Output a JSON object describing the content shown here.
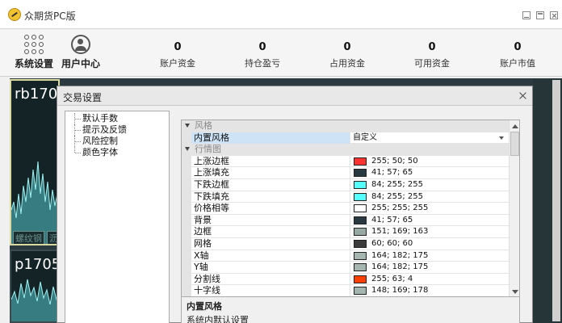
{
  "window": {
    "title": "众期货PC版"
  },
  "toolbar": {
    "system_settings": "系统设置",
    "user_center": "用户中心",
    "stats": [
      {
        "value": "0",
        "label": "账户资金"
      },
      {
        "value": "0",
        "label": "持仓盈亏"
      },
      {
        "value": "0",
        "label": "占用资金"
      },
      {
        "value": "0",
        "label": "可用资金"
      },
      {
        "value": "0",
        "label": "账户市值"
      }
    ]
  },
  "charts": {
    "panel1_symbol": "rb170",
    "panel2_symbol": "p1705",
    "tag1": "螺纹钢",
    "tag2": "沥"
  },
  "dialog": {
    "title": "交易设置",
    "tree": [
      "默认手数",
      "提示及反馈",
      "风险控制",
      "颜色字体"
    ],
    "grid": {
      "cat_style": "风格",
      "style_row": {
        "name": "内置风格",
        "value": "自定义"
      },
      "cat_market": "行情图",
      "rows": [
        {
          "name": "上涨边框",
          "color": "#ff3232",
          "value": "255; 50; 50"
        },
        {
          "name": "上涨填充",
          "color": "#293941",
          "value": "41; 57; 65"
        },
        {
          "name": "下跌边框",
          "color": "#54ffff",
          "value": "84; 255; 255"
        },
        {
          "name": "下跌填充",
          "color": "#54ffff",
          "value": "84; 255; 255"
        },
        {
          "name": "价格相等",
          "color": "#ffffff",
          "value": "255; 255; 255"
        },
        {
          "name": "背景",
          "color": "#293941",
          "value": "41; 57; 65"
        },
        {
          "name": "边框",
          "color": "#97a9a3",
          "value": "151; 169; 163"
        },
        {
          "name": "网格",
          "color": "#3c3c3c",
          "value": "60; 60; 60"
        },
        {
          "name": "X轴",
          "color": "#a4b6af",
          "value": "164; 182; 175"
        },
        {
          "name": "Y轴",
          "color": "#a4b6af",
          "value": "164; 182; 175"
        },
        {
          "name": "分割线",
          "color": "#ff3f04",
          "value": "255; 63; 4"
        },
        {
          "name": "十字线",
          "color": "#a4b6af",
          "value": "148; 169; 178"
        }
      ]
    },
    "description": {
      "title": "内置风格",
      "text": "系统内默认设置"
    }
  }
}
